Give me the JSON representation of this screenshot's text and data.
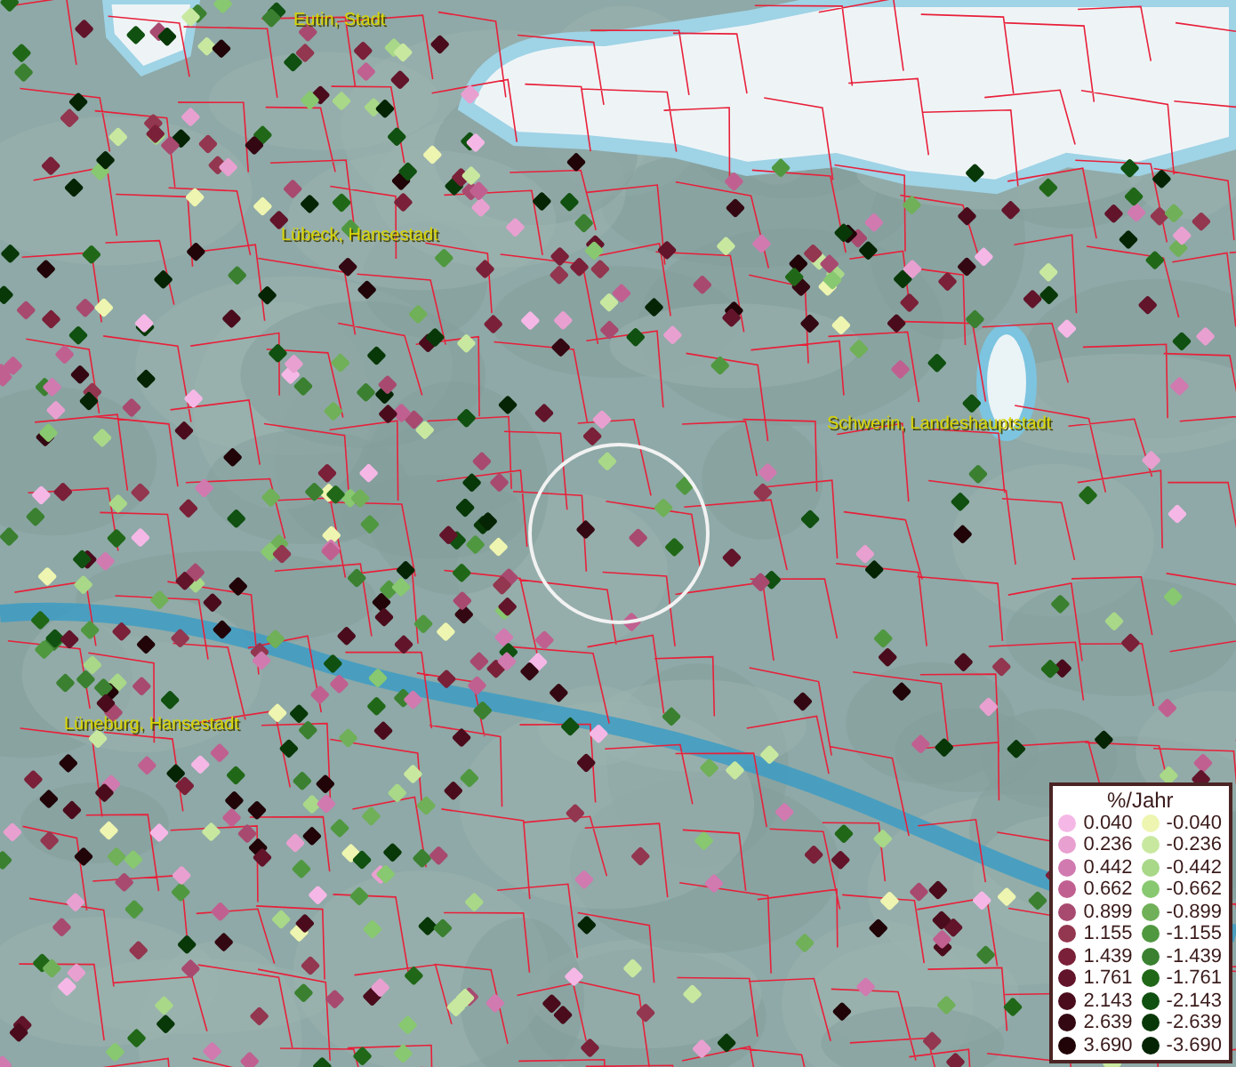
{
  "map": {
    "places": [
      {
        "label": "Eutin, Stadt"
      },
      {
        "label": "Lübeck, Hansestadt"
      },
      {
        "label": "Schwerin, Landeshauptstadt"
      },
      {
        "label": "Lüneburg, Hansestadt"
      }
    ]
  },
  "legend": {
    "title": "%/Jahr",
    "columns": [
      {
        "entries": [
          {
            "label": "0.040",
            "color": "#f5b8e6"
          },
          {
            "label": "0.236",
            "color": "#e8a0d0"
          },
          {
            "label": "0.442",
            "color": "#d07ab0"
          },
          {
            "label": "0.662",
            "color": "#c06090"
          },
          {
            "label": "0.899",
            "color": "#a84a70"
          },
          {
            "label": "1.155",
            "color": "#93364f"
          },
          {
            "label": "1.439",
            "color": "#7a2038"
          },
          {
            "label": "1.761",
            "color": "#62142a"
          },
          {
            "label": "2.143",
            "color": "#4a0c1c"
          },
          {
            "label": "2.639",
            "color": "#340812"
          },
          {
            "label": "3.690",
            "color": "#200408"
          }
        ]
      },
      {
        "entries": [
          {
            "label": "-0.040",
            "color": "#eef5b0"
          },
          {
            "label": "-0.236",
            "color": "#c8e8a0"
          },
          {
            "label": "-0.442",
            "color": "#a8d888"
          },
          {
            "label": "-0.662",
            "color": "#88c870"
          },
          {
            "label": "-0.899",
            "color": "#70b058"
          },
          {
            "label": "-1.155",
            "color": "#509840"
          },
          {
            "label": "-1.439",
            "color": "#3a8030"
          },
          {
            "label": "-1.761",
            "color": "#206818"
          },
          {
            "label": "-2.143",
            "color": "#105010"
          },
          {
            "label": "-2.639",
            "color": "#083808"
          },
          {
            "label": "-3.690",
            "color": "#042404"
          }
        ]
      }
    ]
  }
}
